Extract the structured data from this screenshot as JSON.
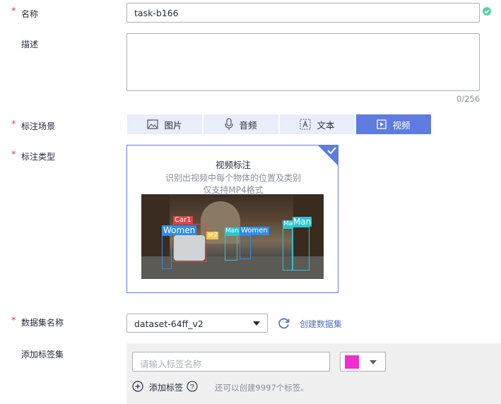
{
  "name": {
    "label": "名称",
    "value": "task-b166"
  },
  "description": {
    "label": "描述",
    "placeholder": "",
    "counter": "0/256"
  },
  "scene": {
    "label": "标注场景",
    "tabs": [
      {
        "label": "图片",
        "icon": "image-icon",
        "active": false
      },
      {
        "label": "音频",
        "icon": "microphone-icon",
        "active": false
      },
      {
        "label": "文本",
        "icon": "text-icon",
        "active": false
      },
      {
        "label": "视频",
        "icon": "video-icon",
        "active": true
      }
    ]
  },
  "type": {
    "label": "标注类型",
    "card_title": "视频标注",
    "card_desc1": "识别出视频中每个物体的位置及类别",
    "card_desc2": "仅支持MP4格式",
    "image_boxes": [
      {
        "label": "Car1",
        "color": "#e0424b"
      },
      {
        "label": "Women",
        "color": "#2f8ee5"
      },
      {
        "label": "ar2",
        "color": "#f2c94c"
      },
      {
        "label": "Man",
        "color": "#2bc7cf"
      },
      {
        "label": "Women",
        "color": "#2f8ee5"
      },
      {
        "label": "Ma",
        "color": "#2bc7cf"
      },
      {
        "label": "Man",
        "color": "#2bc7cf"
      }
    ]
  },
  "dataset": {
    "label": "数据集名称",
    "value": "dataset-64ff_v2",
    "create_link": "创建数据集"
  },
  "tagset": {
    "label": "添加标签集",
    "input_placeholder": "请输入标签名称",
    "color": "#f02dce",
    "add_label": "添加标签",
    "hint": "还可以创建9997个标签。"
  }
}
